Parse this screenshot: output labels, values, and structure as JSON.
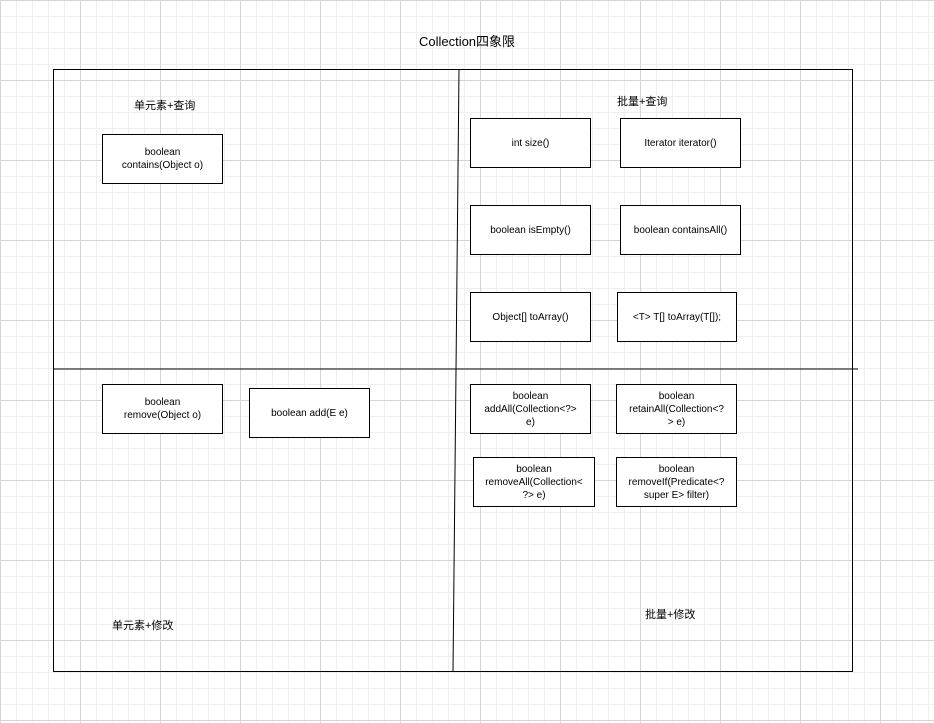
{
  "title": "Collection四象限",
  "quadrants": {
    "top_left": {
      "label": "单元素+查询",
      "methods": [
        "boolean\ncontains(Object o)"
      ]
    },
    "top_right": {
      "label": "批量+查询",
      "methods": [
        "int size()",
        "Iterator iterator()",
        "boolean isEmpty()",
        "boolean containsAll()",
        "Object[] toArray()",
        "<T> T[] toArray(T[]);"
      ]
    },
    "bottom_left": {
      "label": "单元素+修改",
      "methods": [
        "boolean\nremove(Object o)",
        "boolean add(E e)"
      ]
    },
    "bottom_right": {
      "label": "批量+修改",
      "methods": [
        "boolean\naddAll(Collection<?>\ne)",
        "boolean\nretainAll(Collection<?\n> e)",
        "boolean\nremoveAll(Collection<\n?> e)",
        "boolean\nremoveIf(Predicate<?\nsuper E> filter)"
      ]
    }
  }
}
